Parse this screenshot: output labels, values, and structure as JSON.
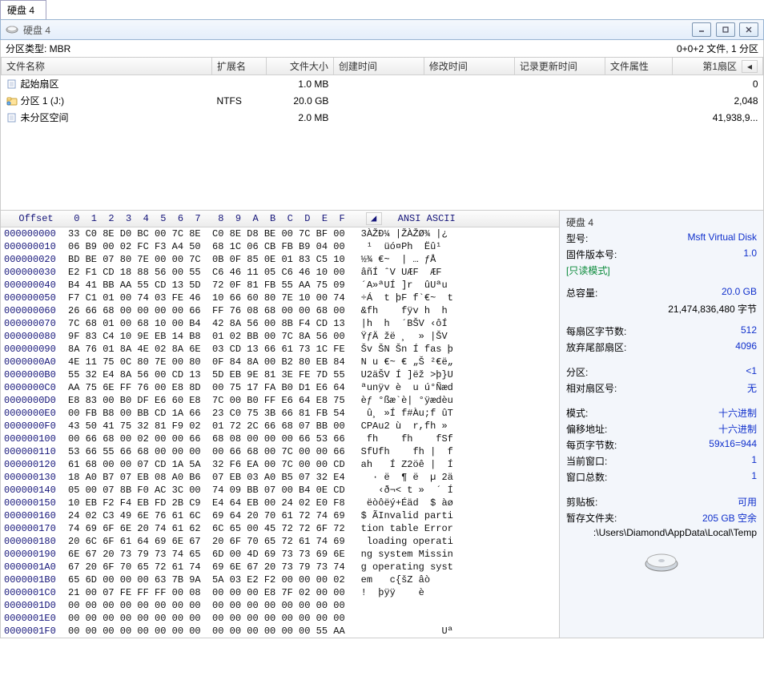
{
  "outer_tab": "硬盘 4",
  "panel_title": "硬盘 4",
  "info_left": "分区类型: MBR",
  "info_right": "0+0+2 文件, 1 分区",
  "columns": {
    "name": "文件名称",
    "ext": "扩展名",
    "size": "文件大小",
    "created": "创建时间",
    "modified": "修改时间",
    "record": "记录更新时间",
    "attr": "文件属性",
    "first_sector": "第1扇区"
  },
  "rows": [
    {
      "name": "起始扇区",
      "ext": "",
      "size": "1.0 MB",
      "first": "0",
      "icon": "sector"
    },
    {
      "name": "分区 1 (J:)",
      "ext": "NTFS",
      "size": "20.0 GB",
      "first": "2,048",
      "icon": "part"
    },
    {
      "name": "未分区空间",
      "ext": "",
      "size": "2.0 MB",
      "first": "41,938,9...",
      "icon": "sector"
    }
  ],
  "hex_header_offset": "Offset",
  "hex_header_cols": " 0  1  2  3  4  5  6  7  8  9  A  B  C  D  E  F",
  "hex_header_ascii": "ANSI ASCII",
  "hex_rows": [
    {
      "o": "000000000",
      "b": "33 C0 8E D0 BC 00 7C 8E  C0 8E D8 BE 00 7C BF 00",
      "a": "3ÀŽÐ¼ |ŽÀŽØ¾ |¿"
    },
    {
      "o": "000000010",
      "b": "06 B9 00 02 FC F3 A4 50  68 1C 06 CB FB B9 04 00",
      "a": " ¹  üó¤Ph  Ëû¹"
    },
    {
      "o": "000000020",
      "b": "BD BE 07 80 7E 00 00 7C  0B 0F 85 0E 01 83 C5 10",
      "a": "½¾ €~  | … ƒÅ"
    },
    {
      "o": "000000030",
      "b": "E2 F1 CD 18 88 56 00 55  C6 46 11 05 C6 46 10 00",
      "a": "âñÍ ˆV UÆF  ÆF"
    },
    {
      "o": "000000040",
      "b": "B4 41 BB AA 55 CD 13 5D  72 0F 81 FB 55 AA 75 09",
      "a": "´A»ªUÍ ]r  ûUªu"
    },
    {
      "o": "000000050",
      "b": "F7 C1 01 00 74 03 FE 46  10 66 60 80 7E 10 00 74",
      "a": "÷Á  t þF f`€~  t"
    },
    {
      "o": "000000060",
      "b": "26 66 68 00 00 00 00 66  FF 76 08 68 00 00 68 00",
      "a": "&fh    fÿv h  h"
    },
    {
      "o": "000000070",
      "b": "7C 68 01 00 68 10 00 B4  42 8A 56 00 8B F4 CD 13",
      "a": "|h  h  ´BŠV ‹ôÍ"
    },
    {
      "o": "000000080",
      "b": "9F 83 C4 10 9E EB 14 B8  01 02 BB 00 7C 8A 56 00",
      "a": "ŸƒÄ žë ¸  » |ŠV"
    },
    {
      "o": "000000090",
      "b": "8A 76 01 8A 4E 02 8A 6E  03 CD 13 66 61 73 1C FE",
      "a": "Šv ŠN Šn Í fas þ"
    },
    {
      "o": "0000000A0",
      "b": "4E 11 75 0C 80 7E 00 80  0F 84 8A 00 B2 80 EB 84",
      "a": "N u €~ € „Š ²€ë„"
    },
    {
      "o": "0000000B0",
      "b": "55 32 E4 8A 56 00 CD 13  5D EB 9E 81 3E FE 7D 55",
      "a": "U2äŠV Í ]ëž >þ}U"
    },
    {
      "o": "0000000C0",
      "b": "AA 75 6E FF 76 00 E8 8D  00 75 17 FA B0 D1 E6 64",
      "a": "ªunÿv è  u ú°Ñæd"
    },
    {
      "o": "0000000D0",
      "b": "E8 83 00 B0 DF E6 60 E8  7C 00 B0 FF E6 64 E8 75",
      "a": "èƒ °ßæ`è| °ÿædèu"
    },
    {
      "o": "0000000E0",
      "b": "00 FB B8 00 BB CD 1A 66  23 C0 75 3B 66 81 FB 54",
      "a": " û¸ »Í f#Àu;f ûT"
    },
    {
      "o": "0000000F0",
      "b": "43 50 41 75 32 81 F9 02  01 72 2C 66 68 07 BB 00",
      "a": "CPAu2 ù  r,fh »"
    },
    {
      "o": "000000100",
      "b": "00 66 68 00 02 00 00 66  68 08 00 00 00 66 53 66",
      "a": " fh    fh    fSf"
    },
    {
      "o": "000000110",
      "b": "53 66 55 66 68 00 00 00  00 66 68 00 7C 00 00 66",
      "a": "SfUfh    fh |  f"
    },
    {
      "o": "000000120",
      "b": "61 68 00 00 07 CD 1A 5A  32 F6 EA 00 7C 00 00 CD",
      "a": "ah   Í Z2öê |  Í"
    },
    {
      "o": "000000130",
      "b": "18 A0 B7 07 EB 08 A0 B6  07 EB 03 A0 B5 07 32 E4",
      "a": "  · ë  ¶ ë  µ 2ä"
    },
    {
      "o": "000000140",
      "b": "05 00 07 8B F0 AC 3C 00  74 09 BB 07 00 B4 0E CD",
      "a": "   ‹ð¬< t »  ´ Í"
    },
    {
      "o": "000000150",
      "b": "10 EB F2 F4 EB FD 2B C9  E4 64 EB 00 24 02 E0 F8",
      "a": " ëòôëý+Éäd  $ àø"
    },
    {
      "o": "000000160",
      "b": "24 02 C3 49 6E 76 61 6C  69 64 20 70 61 72 74 69",
      "a": "$ ÃInvalid parti"
    },
    {
      "o": "000000170",
      "b": "74 69 6F 6E 20 74 61 62  6C 65 00 45 72 72 6F 72",
      "a": "tion table Error"
    },
    {
      "o": "000000180",
      "b": "20 6C 6F 61 64 69 6E 67  20 6F 70 65 72 61 74 69",
      "a": " loading operati"
    },
    {
      "o": "000000190",
      "b": "6E 67 20 73 79 73 74 65  6D 00 4D 69 73 73 69 6E",
      "a": "ng system Missin"
    },
    {
      "o": "0000001A0",
      "b": "67 20 6F 70 65 72 61 74  69 6E 67 20 73 79 73 74",
      "a": "g operating syst"
    },
    {
      "o": "0000001B0",
      "b": "65 6D 00 00 00 63 7B 9A  5A 03 E2 F2 00 00 00 02",
      "a": "em   c{šZ âò"
    },
    {
      "o": "0000001C0",
      "b": "21 00 07 FE FF FF 00 08  00 00 00 E8 7F 02 00 00",
      "a": "!  þÿÿ    è"
    },
    {
      "o": "0000001D0",
      "b": "00 00 00 00 00 00 00 00  00 00 00 00 00 00 00 00",
      "a": ""
    },
    {
      "o": "0000001E0",
      "b": "00 00 00 00 00 00 00 00  00 00 00 00 00 00 00 00",
      "a": ""
    },
    {
      "o": "0000001F0",
      "b": "00 00 00 00 00 00 00 00  00 00 00 00 00 00 55 AA",
      "a": "              Uª"
    }
  ],
  "side": {
    "title": "硬盘 4",
    "model_l": "型号:",
    "model_v": "Msft Virtual Disk",
    "fw_l": "固件版本号:",
    "fw_v": "1.0",
    "ro": "[只读模式]",
    "cap_l": "总容量:",
    "cap_v": "20.0 GB",
    "cap_bytes": "21,474,836,480 字节",
    "bps_l": "每扇区字节数:",
    "bps_v": "512",
    "tail_l": "放弃尾部扇区:",
    "tail_v": "4096",
    "part_l": "分区:",
    "part_v": "<1",
    "rel_l": "相对扇区号:",
    "rel_v": "无",
    "mode_l": "模式:",
    "mode_v": "十六进制",
    "offaddr_l": "偏移地址:",
    "offaddr_v": "十六进制",
    "bpp_l": "每页字节数:",
    "bpp_v": "59x16=944",
    "curw_l": "当前窗口:",
    "curw_v": "1",
    "totw_l": "窗口总数:",
    "totw_v": "1",
    "clip_l": "剪贴板:",
    "clip_v": "可用",
    "tmp_l": "暂存文件夹:",
    "tmp_v": "205 GB 空余",
    "tmp_path": ":\\Users\\Diamond\\AppData\\Local\\Temp"
  }
}
